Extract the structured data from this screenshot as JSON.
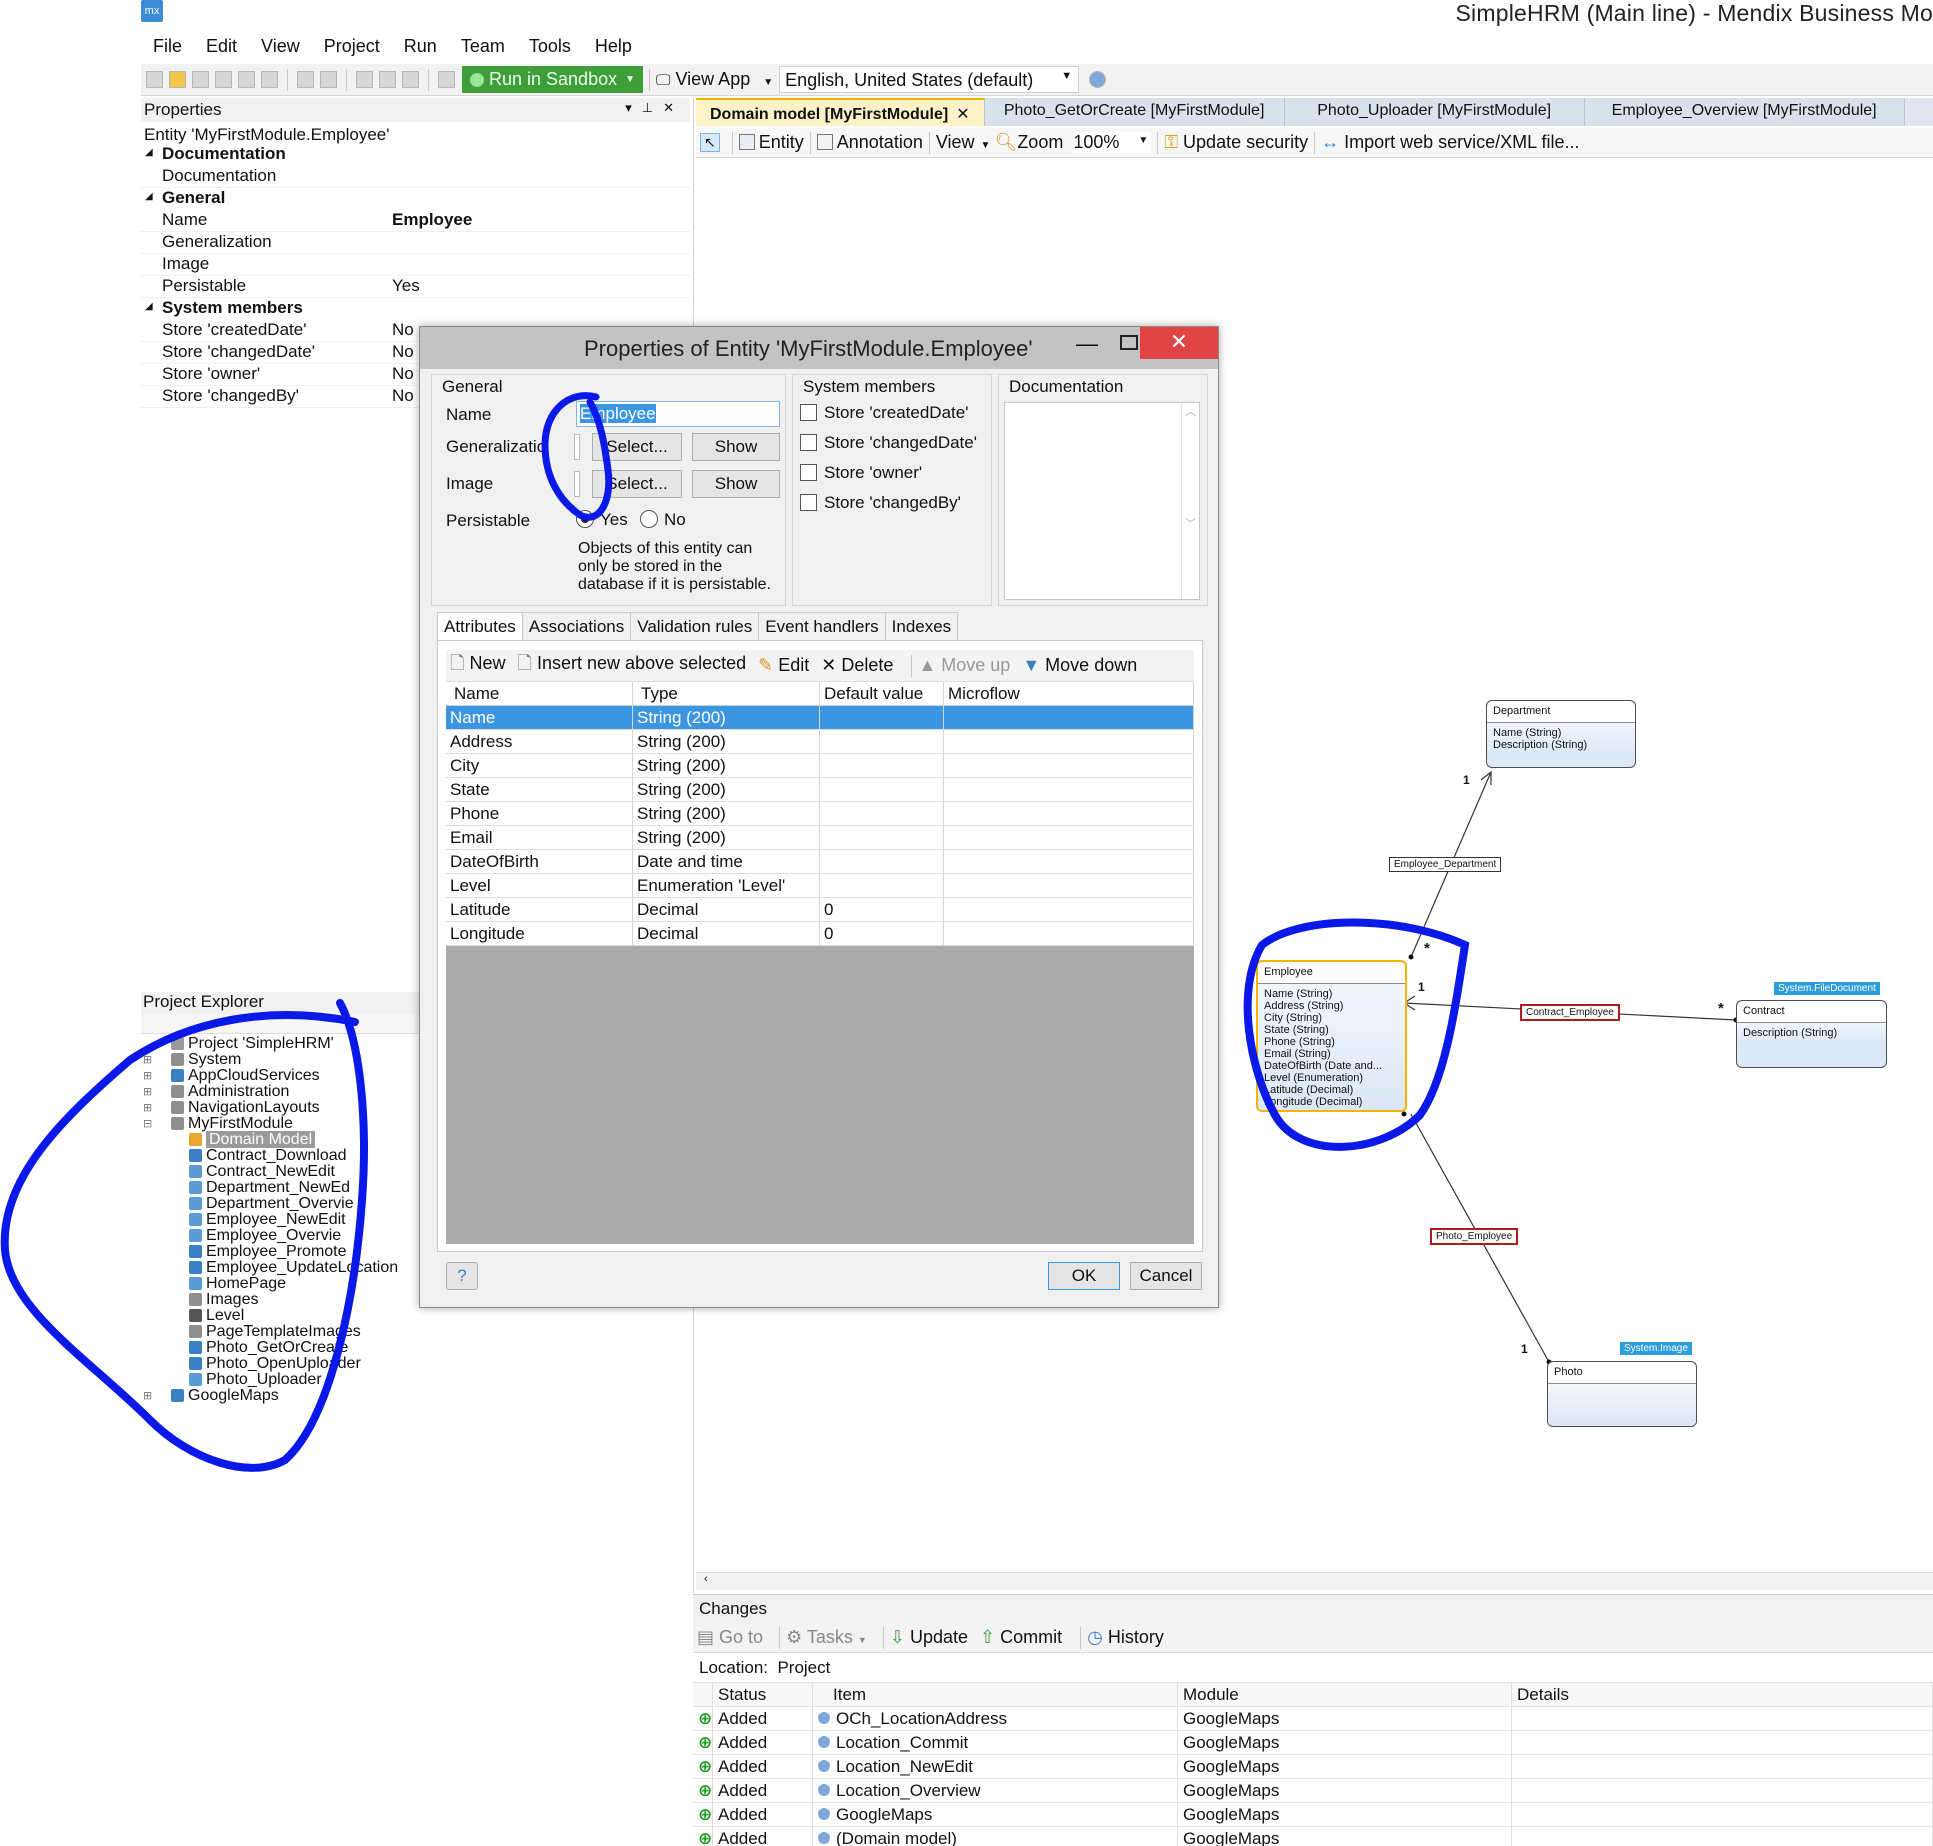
{
  "window": {
    "title": "SimpleHRM (Main line) - Mendix Business Mo",
    "logo_text": "mx"
  },
  "menu": [
    "File",
    "Edit",
    "View",
    "Project",
    "Run",
    "Team",
    "Tools",
    "Help"
  ],
  "main_toolbar": {
    "run_label": "Run in Sandbox",
    "view_app_label": "View App",
    "language_value": "English, United States (default)"
  },
  "properties": {
    "title": "Properties",
    "subtitle": "Entity 'MyFirstModule.Employee'",
    "groups": [
      {
        "name": "Documentation",
        "rows": [
          {
            "k": "Documentation",
            "v": ""
          }
        ]
      },
      {
        "name": "General",
        "rows": [
          {
            "k": "Name",
            "v": "Employee",
            "bold": true
          },
          {
            "k": "Generalization",
            "v": ""
          },
          {
            "k": "Image",
            "v": ""
          },
          {
            "k": "Persistable",
            "v": "Yes"
          }
        ]
      },
      {
        "name": "System members",
        "rows": [
          {
            "k": "Store 'createdDate'",
            "v": "No"
          },
          {
            "k": "Store 'changedDate'",
            "v": "No"
          },
          {
            "k": "Store 'owner'",
            "v": "No"
          },
          {
            "k": "Store 'changedBy'",
            "v": "No"
          }
        ]
      }
    ]
  },
  "project_explorer": {
    "title": "Project Explorer",
    "items": [
      {
        "label": "Project 'SimpleHRM'",
        "level": 1,
        "icon": "project-icon",
        "color": "#9a9a9a"
      },
      {
        "label": "System",
        "level": 1,
        "icon": "module-icon",
        "color": "#8f8f8f",
        "expander": "+"
      },
      {
        "label": "AppCloudServices",
        "level": 1,
        "icon": "module-icon",
        "color": "#3b7fc4",
        "expander": "+"
      },
      {
        "label": "Administration",
        "level": 1,
        "icon": "module-icon",
        "color": "#8f8f8f",
        "expander": "+"
      },
      {
        "label": "NavigationLayouts",
        "level": 1,
        "icon": "module-icon",
        "color": "#8f8f8f",
        "expander": "+"
      },
      {
        "label": "MyFirstModule",
        "level": 1,
        "icon": "module-icon",
        "color": "#8f8f8f",
        "expander": "-"
      },
      {
        "label": "Domain Model",
        "level": 2,
        "icon": "domain-model-icon",
        "color": "#e8a82d",
        "selected": true
      },
      {
        "label": "Contract_Download",
        "level": 2,
        "icon": "microflow-icon",
        "color": "#3b7fc4"
      },
      {
        "label": "Contract_NewEdit",
        "level": 2,
        "icon": "page-icon",
        "color": "#5b9bd5"
      },
      {
        "label": "Department_NewEd",
        "level": 2,
        "icon": "page-icon",
        "color": "#5b9bd5"
      },
      {
        "label": "Department_Overvie",
        "level": 2,
        "icon": "page-icon",
        "color": "#5b9bd5"
      },
      {
        "label": "Employee_NewEdit",
        "level": 2,
        "icon": "page-icon",
        "color": "#5b9bd5"
      },
      {
        "label": "Employee_Overvie",
        "level": 2,
        "icon": "page-icon",
        "color": "#5b9bd5"
      },
      {
        "label": "Employee_Promote",
        "level": 2,
        "icon": "microflow-icon",
        "color": "#3b7fc4"
      },
      {
        "label": "Employee_UpdateLocation",
        "level": 2,
        "icon": "microflow-icon",
        "color": "#3b7fc4"
      },
      {
        "label": "HomePage",
        "level": 2,
        "icon": "page-icon",
        "color": "#5b9bd5"
      },
      {
        "label": "Images",
        "level": 2,
        "icon": "images-icon",
        "color": "#8f8f8f"
      },
      {
        "label": "Level",
        "level": 2,
        "icon": "enumeration-icon",
        "color": "#555555"
      },
      {
        "label": "PageTemplateImages",
        "level": 2,
        "icon": "images-icon",
        "color": "#8f8f8f"
      },
      {
        "label": "Photo_GetOrCreate",
        "level": 2,
        "icon": "microflow-icon",
        "color": "#3b7fc4"
      },
      {
        "label": "Photo_OpenUploader",
        "level": 2,
        "icon": "microflow-icon",
        "color": "#3b7fc4"
      },
      {
        "label": "Photo_Uploader",
        "level": 2,
        "icon": "page-icon",
        "color": "#5b9bd5"
      },
      {
        "label": "GoogleMaps",
        "level": 1,
        "icon": "module-icon",
        "color": "#3b7fc4",
        "expander": "+"
      }
    ]
  },
  "doc_tabs": [
    {
      "label": "Domain model [MyFirstModule]",
      "active": true
    },
    {
      "label": "Photo_GetOrCreate [MyFirstModule]"
    },
    {
      "label": "Photo_Uploader [MyFirstModule]"
    },
    {
      "label": "Employee_Overview [MyFirstModule]"
    }
  ],
  "dm_toolbar": {
    "entity": "Entity",
    "annotation": "Annotation",
    "view": "View",
    "zoom": "Zoom",
    "zoom_value": "100%",
    "update_security": "Update security",
    "import": "Import web service/XML file..."
  },
  "dialog": {
    "title": "Properties of Entity 'MyFirstModule.Employee'",
    "general": {
      "title": "General",
      "name_label": "Name",
      "name_value": "Employee",
      "generalization_label": "Generalization",
      "image_label": "Image",
      "persistable_label": "Persistable",
      "select_label": "Select...",
      "show_label": "Show",
      "yes_label": "Yes",
      "no_label": "No",
      "hint": "Objects of this entity can only be stored in the database if it is persistable."
    },
    "system_members": {
      "title": "System members",
      "items": [
        "Store 'createdDate'",
        "Store 'changedDate'",
        "Store 'owner'",
        "Store 'changedBy'"
      ]
    },
    "documentation": {
      "title": "Documentation"
    },
    "tabs": [
      "Attributes",
      "Associations",
      "Validation rules",
      "Event handlers",
      "Indexes"
    ],
    "attr_toolbar": {
      "new": "New",
      "insert": "Insert new above selected",
      "edit": "Edit",
      "delete": "Delete",
      "move_up": "Move up",
      "move_down": "Move down"
    },
    "columns": [
      "Name",
      "Type",
      "Default value",
      "Microflow"
    ],
    "attributes": [
      {
        "name": "Name",
        "type": "String (200)",
        "default": "",
        "microflow": ""
      },
      {
        "name": "Address",
        "type": "String (200)",
        "default": "",
        "microflow": ""
      },
      {
        "name": "City",
        "type": "String (200)",
        "default": "",
        "microflow": ""
      },
      {
        "name": "State",
        "type": "String (200)",
        "default": "",
        "microflow": ""
      },
      {
        "name": "Phone",
        "type": "String (200)",
        "default": "",
        "microflow": ""
      },
      {
        "name": "Email",
        "type": "String (200)",
        "default": "",
        "microflow": ""
      },
      {
        "name": "DateOfBirth",
        "type": "Date and time",
        "default": "",
        "microflow": ""
      },
      {
        "name": "Level",
        "type": "Enumeration 'Level'",
        "default": "",
        "microflow": ""
      },
      {
        "name": "Latitude",
        "type": "Decimal",
        "default": "0",
        "microflow": ""
      },
      {
        "name": "Longitude",
        "type": "Decimal",
        "default": "0",
        "microflow": ""
      }
    ],
    "ok_label": "OK",
    "cancel_label": "Cancel"
  },
  "diagram": {
    "department": {
      "name": "Department",
      "attrs": [
        "Name (String)",
        "Description (String)"
      ]
    },
    "employee": {
      "name": "Employee",
      "attrs": [
        "Name (String)",
        "Address (String)",
        "City (String)",
        "State (String)",
        "Phone (String)",
        "Email (String)",
        "DateOfBirth (Date and...",
        "Level (Enumeration)",
        "Latitude (Decimal)",
        "Longitude (Decimal)"
      ]
    },
    "contract": {
      "name": "Contract",
      "attrs": [
        "Description (String)"
      ],
      "tag": "System.FileDocument"
    },
    "photo": {
      "name": "Photo",
      "attrs": [],
      "tag": "System.Image"
    },
    "assoc_dept": "Employee_Department",
    "assoc_contract": "Contract_Employee",
    "assoc_photo": "Photo_Employee",
    "mult_one": "1",
    "mult_many": "*"
  },
  "changes": {
    "title": "Changes",
    "toolbar": {
      "goto": "Go to",
      "tasks": "Tasks",
      "update": "Update",
      "commit": "Commit",
      "history": "History"
    },
    "location_label": "Location:",
    "location_value": "Project",
    "columns": [
      "Status",
      "Item",
      "Module",
      "Details"
    ],
    "rows": [
      {
        "status": "Added",
        "item": "OCh_LocationAddress",
        "module": "GoogleMaps"
      },
      {
        "status": "Added",
        "item": "Location_Commit",
        "module": "GoogleMaps"
      },
      {
        "status": "Added",
        "item": "Location_NewEdit",
        "module": "GoogleMaps"
      },
      {
        "status": "Added",
        "item": "Location_Overview",
        "module": "GoogleMaps"
      },
      {
        "status": "Added",
        "item": "GoogleMaps",
        "module": "GoogleMaps"
      },
      {
        "status": "Added",
        "item": "(Domain model)",
        "module": "GoogleMaps"
      }
    ]
  },
  "colors": {
    "accent": "#3c95e0",
    "annotation_stroke": "#0a18e8",
    "selected_entity": "#f4b400",
    "run_green": "#3f9d3a"
  }
}
